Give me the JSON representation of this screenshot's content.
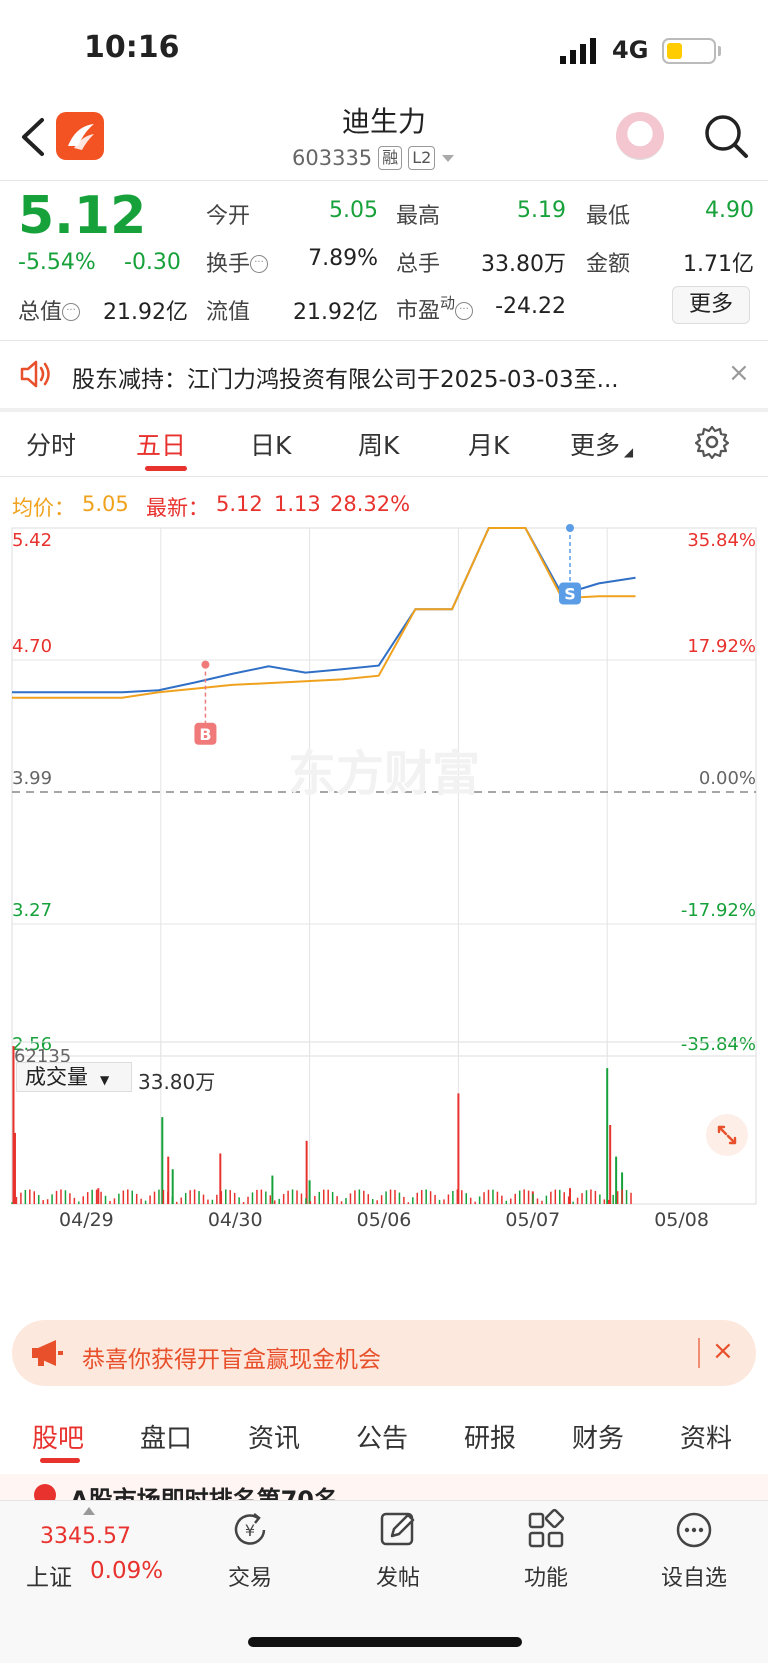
{
  "status_bar": {
    "time": "10:16",
    "network": "4G"
  },
  "header": {
    "name": "迪生力",
    "code": "603335",
    "tag_margin": "融",
    "tag_level": "L2"
  },
  "quote": {
    "price": "5.12",
    "change_pct": "-5.54%",
    "change_amt": "-0.30",
    "open_label": "今开",
    "open": "5.05",
    "high_label": "最高",
    "high": "5.19",
    "low_label": "最低",
    "low": "4.90",
    "turnover_label": "换手",
    "turnover": "7.89%",
    "volume_label": "总手",
    "volume": "33.80万",
    "amount_label": "金额",
    "amount": "1.71亿",
    "mktcap_label": "总值",
    "mktcap": "21.92亿",
    "float_label": "流值",
    "float_cap": "21.92亿",
    "pe_label": "市盈",
    "pe_sup": "动",
    "pe": "-24.22",
    "more_label": "更多"
  },
  "notice": {
    "text": "股东减持：江门力鸿投资有限公司于2025-03-03至...",
    "close": "×"
  },
  "period_tabs": [
    "分时",
    "五日",
    "日K",
    "周K",
    "月K",
    "更多"
  ],
  "chart_header": {
    "avg_label": "均价：",
    "avg": "5.05",
    "latest_label": "最新：",
    "latest": "5.12",
    "latest_chg": "1.13",
    "latest_pct": "28.32%"
  },
  "chart_data": {
    "type": "line",
    "y_ticks": [
      "5.42",
      "4.70",
      "3.99",
      "3.27",
      "2.56"
    ],
    "pct_ticks": [
      "35.84%",
      "17.92%",
      "0.00%",
      "-17.92%",
      "-35.84%"
    ],
    "x_labels": [
      "04/29",
      "04/30",
      "05/06",
      "05/07",
      "05/08"
    ],
    "markers": [
      {
        "label": "B",
        "day": "04/30"
      },
      {
        "label": "S",
        "day": "05/07"
      }
    ],
    "series": [
      {
        "values": [
          4.53,
          4.53,
          4.53,
          4.53,
          4.55,
          4.57,
          4.6,
          4.64,
          4.62,
          4.66,
          4.7,
          4.98,
          4.98,
          5.42,
          5.42,
          5.06,
          5.12,
          5.15
        ]
      },
      {
        "values": [
          4.5,
          4.5,
          4.5,
          4.5,
          4.53,
          4.55,
          4.57,
          4.58,
          4.59,
          4.6,
          4.62,
          4.98,
          4.98,
          5.42,
          5.42,
          5.04,
          5.05,
          5.05
        ]
      }
    ],
    "volume_max_label": "62135",
    "volume_total_label": "33.80万"
  },
  "volume_selector": "成交量",
  "watermark": "东方财富",
  "promo": {
    "text": "恭喜你获得开盲盒赢现金机会",
    "close": "×"
  },
  "bottom_tabs": [
    "股吧",
    "盘口",
    "资讯",
    "公告",
    "研报",
    "财务",
    "资料"
  ],
  "peek_text": "A股市场即时排名第70名",
  "toolbar": {
    "index_value": "3345.57",
    "index_name": "上证",
    "index_pct": "0.09%",
    "trade": "交易",
    "post": "发帖",
    "functions": "功能",
    "watchlist": "设自选"
  }
}
